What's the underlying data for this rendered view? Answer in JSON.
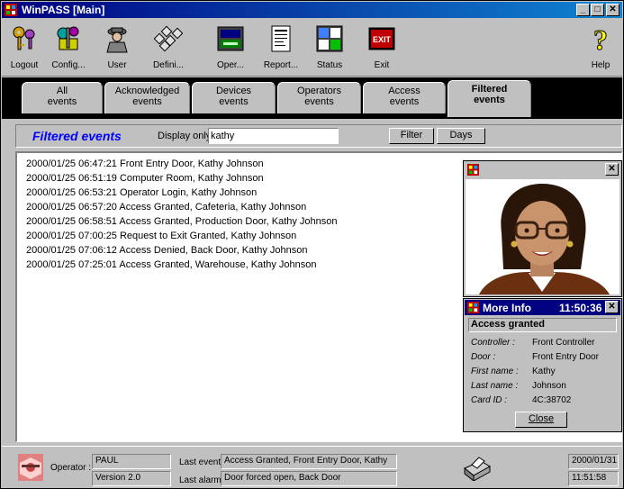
{
  "window": {
    "title": "WinPASS  [Main]"
  },
  "toolbar": [
    {
      "label": "Logout",
      "icon": "keys-icon"
    },
    {
      "label": "Config...",
      "icon": "config-icon"
    },
    {
      "label": "User",
      "icon": "user-icon"
    },
    {
      "label": "Defini...",
      "icon": "definitions-icon"
    },
    {
      "label": "Oper...",
      "icon": "operator-icon"
    },
    {
      "label": "Report...",
      "icon": "report-icon"
    },
    {
      "label": "Status",
      "icon": "status-icon"
    },
    {
      "label": "Exit",
      "icon": "exit-icon"
    },
    {
      "label": "Help",
      "icon": "help-icon"
    }
  ],
  "exit_badge": "EXIT",
  "help_glyph": "?",
  "tabs": [
    {
      "line1": "All",
      "line2": "events"
    },
    {
      "line1": "Acknowledged",
      "line2": "events"
    },
    {
      "line1": "Devices",
      "line2": "events"
    },
    {
      "line1": "Operators",
      "line2": "events"
    },
    {
      "line1": "Access",
      "line2": "events"
    },
    {
      "line1": "Filtered",
      "line2": "events"
    }
  ],
  "filter": {
    "title": "Filtered events",
    "display_only_label": "Display only:",
    "value": "kathy",
    "filter_button": "Filter",
    "days_button": "Days"
  },
  "events": [
    "2000/01/25   06:47:21  Front Entry Door, Kathy Johnson",
    "2000/01/25   06:51:19  Computer Room, Kathy Johnson",
    "2000/01/25   06:53:21  Operator Login, Kathy Johnson",
    "2000/01/25   06:57:20  Access Granted, Cafeteria, Kathy Johnson",
    "2000/01/25   06:58:51  Access Granted, Production Door, Kathy Johnson",
    "2000/01/25   07:00:25  Request to Exit Granted, Kathy Johnson",
    "2000/01/25   07:06:12  Access Denied, Back Door, Kathy Johnson",
    "2000/01/25   07:25:01  Access Granted, Warehouse, Kathy Johnson"
  ],
  "more_info": {
    "title": "More Info",
    "time": "11:50:36",
    "status": "Access granted",
    "fields": [
      {
        "label": "Controller :",
        "value": "Front Controller"
      },
      {
        "label": "Door :",
        "value": "Front Entry Door"
      },
      {
        "label": "First name :",
        "value": "Kathy"
      },
      {
        "label": "Last name :",
        "value": "Johnson"
      },
      {
        "label": "Card ID :",
        "value": "4C:38702"
      }
    ],
    "close_button": "Close"
  },
  "statusbar": {
    "operator_label": "Operator :",
    "operator": "PAUL",
    "version": "Version 2.0",
    "last_event_label": "Last event",
    "last_event": "Access Granted, Front Entry Door, Kathy",
    "last_alarm_label": "Last alarm",
    "last_alarm": "Door forced open, Back Door",
    "date": "2000/01/31",
    "time": "11:51:58"
  },
  "colors": {
    "title_bar": "#000080",
    "accent_text": "#0000ff",
    "window_bg": "#c0c0c0"
  }
}
